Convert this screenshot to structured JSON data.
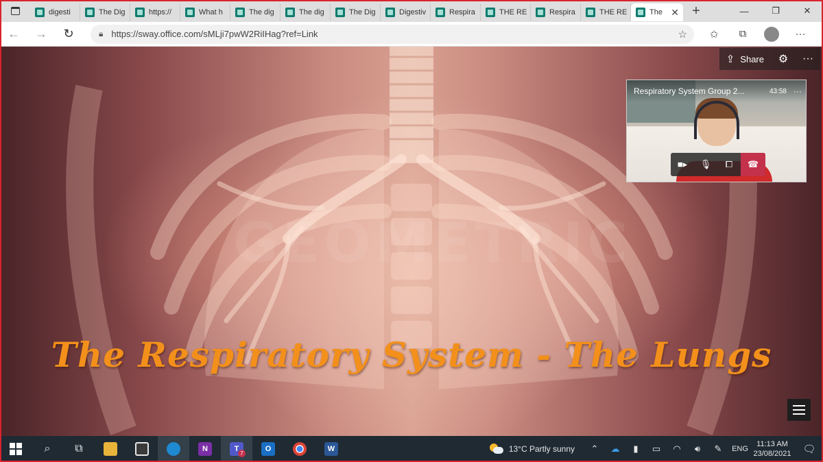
{
  "browser": {
    "tabs": [
      {
        "title": "digesti"
      },
      {
        "title": "The Dig"
      },
      {
        "title": "https://"
      },
      {
        "title": "What h"
      },
      {
        "title": "The dig"
      },
      {
        "title": "The dig"
      },
      {
        "title": "The Dig"
      },
      {
        "title": "Digestiv"
      },
      {
        "title": "Respira"
      },
      {
        "title": "THE RE"
      },
      {
        "title": "Respira"
      },
      {
        "title": "THE RE"
      }
    ],
    "active_tab": {
      "title": "The"
    },
    "new_tab_label": "+",
    "url": "https://sway.office.com/sMLji7pwW2RiIHag?ref=Link"
  },
  "sway": {
    "share_label": "Share",
    "title": "The Respiratory System - The Lungs",
    "watermark": "GEOMETRIC"
  },
  "call": {
    "title": "Respiratory System Group 2...",
    "duration": "43:58"
  },
  "taskbar": {
    "weather_temp": "13°C",
    "weather_text": "Partly sunny",
    "language": "ENG",
    "time": "11:13 AM",
    "date": "23/08/2021",
    "teams_badge": "7"
  },
  "colors": {
    "title_orange": "#f3901b",
    "frame_red": "#d9232e",
    "hangup_red": "#c4314b",
    "taskbar_bg": "#1f2a33"
  }
}
